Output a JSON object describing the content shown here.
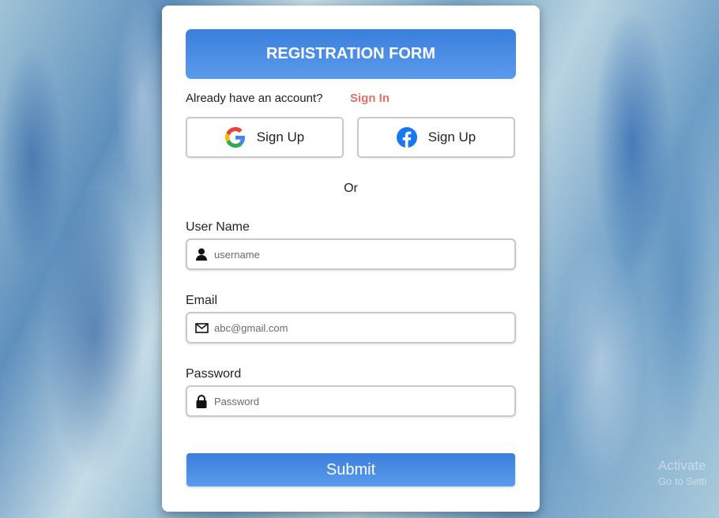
{
  "form": {
    "title": "REGISTRATION FORM",
    "account_prompt": "Already have an account?",
    "sign_in_link": "Sign In",
    "google_signup_label": "Sign Up",
    "facebook_signup_label": "Sign Up",
    "or_text": "Or",
    "username": {
      "label": "User Name",
      "placeholder": "username",
      "icon": "user-icon"
    },
    "email": {
      "label": "Email",
      "placeholder": "abc@gmail.com",
      "icon": "envelope-icon"
    },
    "password": {
      "label": "Password",
      "placeholder": "Password",
      "icon": "lock-icon"
    },
    "submit_label": "Submit"
  },
  "watermark": {
    "line1": "Activate",
    "line2": "Go to Setti"
  },
  "colors": {
    "accent": "#3a7fdc",
    "link": "#e07066",
    "facebook": "#1877f2"
  }
}
